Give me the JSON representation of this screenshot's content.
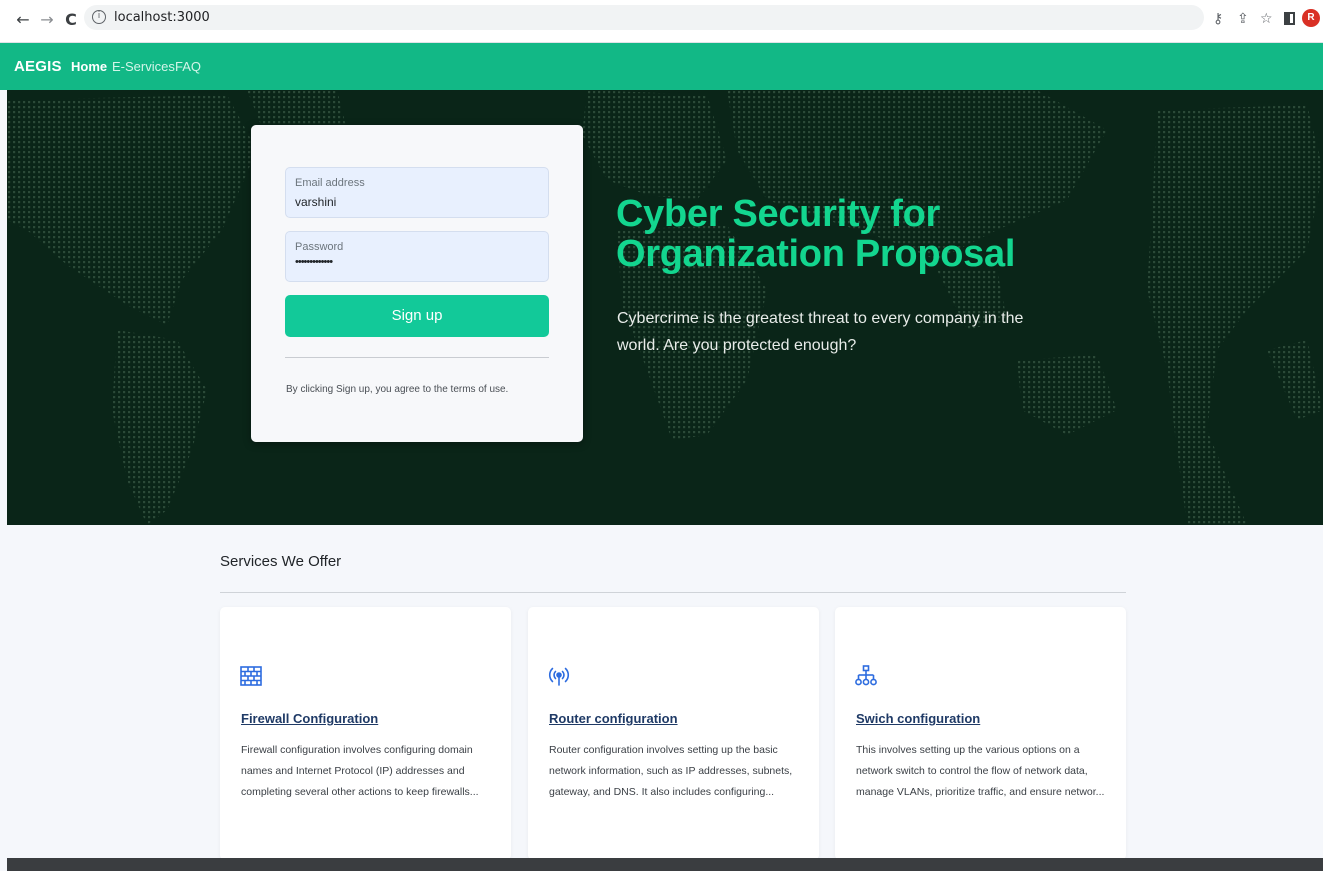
{
  "browser": {
    "url": "localhost:3000",
    "avatar_letter": "R"
  },
  "nav": {
    "brand": "AEGIS",
    "links": [
      "Home",
      "E-Services",
      "FAQ"
    ],
    "accent_color": "#12b886"
  },
  "login": {
    "email_label": "Email address",
    "email_value": "varshini",
    "password_label": "Password",
    "password_value": "•••••••••••••",
    "signup_label": "Sign up",
    "terms": "By clicking Sign up, you agree to the terms of use."
  },
  "hero": {
    "title": "Cyber Security for Organization Proposal",
    "subtitle": "Cybercrime is the greatest threat to every company in the world. Are you protected enough?",
    "title_color": "#13d68f"
  },
  "services": {
    "heading": "Services We Offer",
    "items": [
      {
        "icon": "firewall-icon",
        "title": "Firewall Configuration",
        "description": "Firewall configuration involves configuring domain names and Internet Protocol (IP) addresses and completing several other actions to keep firewalls..."
      },
      {
        "icon": "router-icon",
        "title": "Router configuration",
        "description": "Router configuration involves setting up the basic network information, such as IP addresses, subnets, gateway, and DNS. It also includes configuring..."
      },
      {
        "icon": "network-switch-icon",
        "title": "Swich configuration",
        "description": "This involves setting up the various options on a network switch to control the flow of network data, manage VLANs, prioritize traffic, and ensure networ..."
      }
    ]
  }
}
